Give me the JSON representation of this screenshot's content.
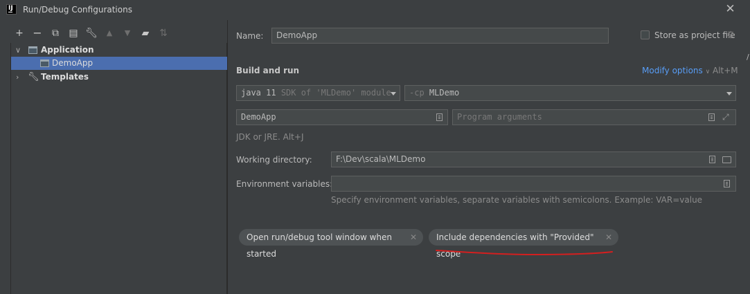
{
  "window": {
    "title": "Run/Debug Configurations",
    "app_icon_text": "IJ"
  },
  "toolbar": {
    "icons": [
      "add-icon",
      "remove-icon",
      "copy-icon",
      "save-icon",
      "wrench-icon",
      "move-up-icon",
      "move-down-icon",
      "new-folder-icon",
      "sort-icon"
    ]
  },
  "tree": {
    "items": [
      {
        "label": "Application",
        "expanded": true
      },
      {
        "label": "DemoApp",
        "selected": true
      },
      {
        "label": "Templates",
        "expanded": false
      }
    ]
  },
  "form": {
    "name_label": "Name:",
    "name_value": "DemoApp",
    "store_label": "Store as project file",
    "section_title": "Build and run",
    "modify_options": "Modify options",
    "modify_shortcut": "Alt+M",
    "jdk_value_main": "java 11",
    "jdk_value_dim": "SDK of 'MLDemo' module",
    "cp_prefix": "-cp",
    "cp_value": "MLDemo",
    "main_class_value": "DemoApp",
    "program_args_placeholder": "Program arguments",
    "jdk_hint": "JDK or JRE. Alt+J",
    "working_dir_label": "Working directory:",
    "working_dir_value": "F:\\Dev\\scala\\MLDemo",
    "env_label": "Environment variables:",
    "env_value": "",
    "env_hint": "Specify environment variables, separate variables with semicolons. Example: VAR=value"
  },
  "chips": [
    {
      "label": "Open run/debug tool window when started"
    },
    {
      "label": "Include dependencies with \"Provided\" scope"
    }
  ],
  "colors": {
    "background": "#3c3f41",
    "selection": "#4b6eaf",
    "link": "#589df6",
    "annotation": "#d41f1f"
  }
}
